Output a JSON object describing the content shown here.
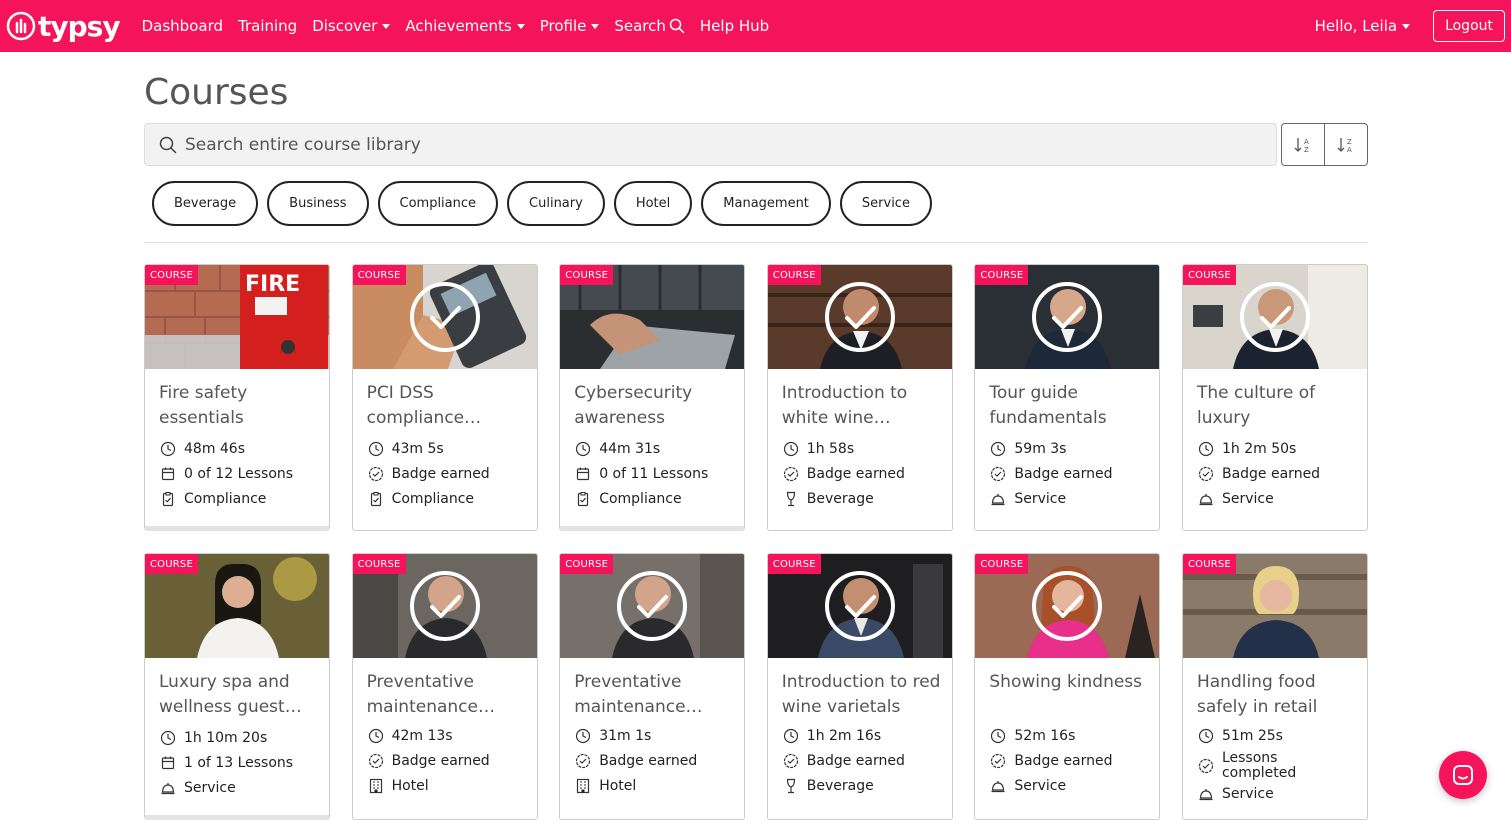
{
  "brand": {
    "name": "typsy",
    "accent": "#f5145c"
  },
  "nav": {
    "items": [
      {
        "label": "Dashboard"
      },
      {
        "label": "Training"
      },
      {
        "label": "Discover"
      },
      {
        "label": "Achievements"
      },
      {
        "label": "Profile"
      },
      {
        "label": "Search"
      },
      {
        "label": "Help Hub"
      }
    ],
    "greeting": "Hello, Leila",
    "logout": "Logout"
  },
  "page": {
    "title": "Courses"
  },
  "search": {
    "placeholder": "Search entire course library"
  },
  "filters": [
    "Beverage",
    "Business",
    "Compliance",
    "Culinary",
    "Hotel",
    "Management",
    "Service"
  ],
  "courses": [
    {
      "tag": "COURSE",
      "title": "Fire safety essentials",
      "duration": "48m 46s",
      "status": "0 of 12 Lessons",
      "category": "Compliance"
    },
    {
      "tag": "COURSE",
      "title": "PCI DSS compliance…",
      "duration": "43m 5s",
      "status": "Badge earned",
      "category": "Compliance"
    },
    {
      "tag": "COURSE",
      "title": "Cybersecurity awareness",
      "duration": "44m 31s",
      "status": "0 of 11 Lessons",
      "category": "Compliance"
    },
    {
      "tag": "COURSE",
      "title": "Introduction to white wine…",
      "duration": "1h 58s",
      "status": "Badge earned",
      "category": "Beverage"
    },
    {
      "tag": "COURSE",
      "title": "Tour guide fundamentals",
      "duration": "59m 3s",
      "status": "Badge earned",
      "category": "Service"
    },
    {
      "tag": "COURSE",
      "title": "The culture of luxury",
      "duration": "1h 2m 50s",
      "status": "Badge earned",
      "category": "Service"
    },
    {
      "tag": "COURSE",
      "title": "Luxury spa and wellness guest…",
      "duration": "1h 10m 20s",
      "status": "1 of 13 Lessons",
      "category": "Service"
    },
    {
      "tag": "COURSE",
      "title": "Preventative maintenance…",
      "duration": "42m 13s",
      "status": "Badge earned",
      "category": "Hotel"
    },
    {
      "tag": "COURSE",
      "title": "Preventative maintenance…",
      "duration": "31m 1s",
      "status": "Badge earned",
      "category": "Hotel"
    },
    {
      "tag": "COURSE",
      "title": "Introduction to red wine varietals",
      "duration": "1h 2m 16s",
      "status": "Badge earned",
      "category": "Beverage"
    },
    {
      "tag": "COURSE",
      "title": "Showing kindness",
      "duration": "52m 16s",
      "status": "Badge earned",
      "category": "Service"
    },
    {
      "tag": "COURSE",
      "title": "Handling food safely in retail",
      "duration": "51m 25s",
      "status": "Lessons completed",
      "category": "Service"
    }
  ]
}
